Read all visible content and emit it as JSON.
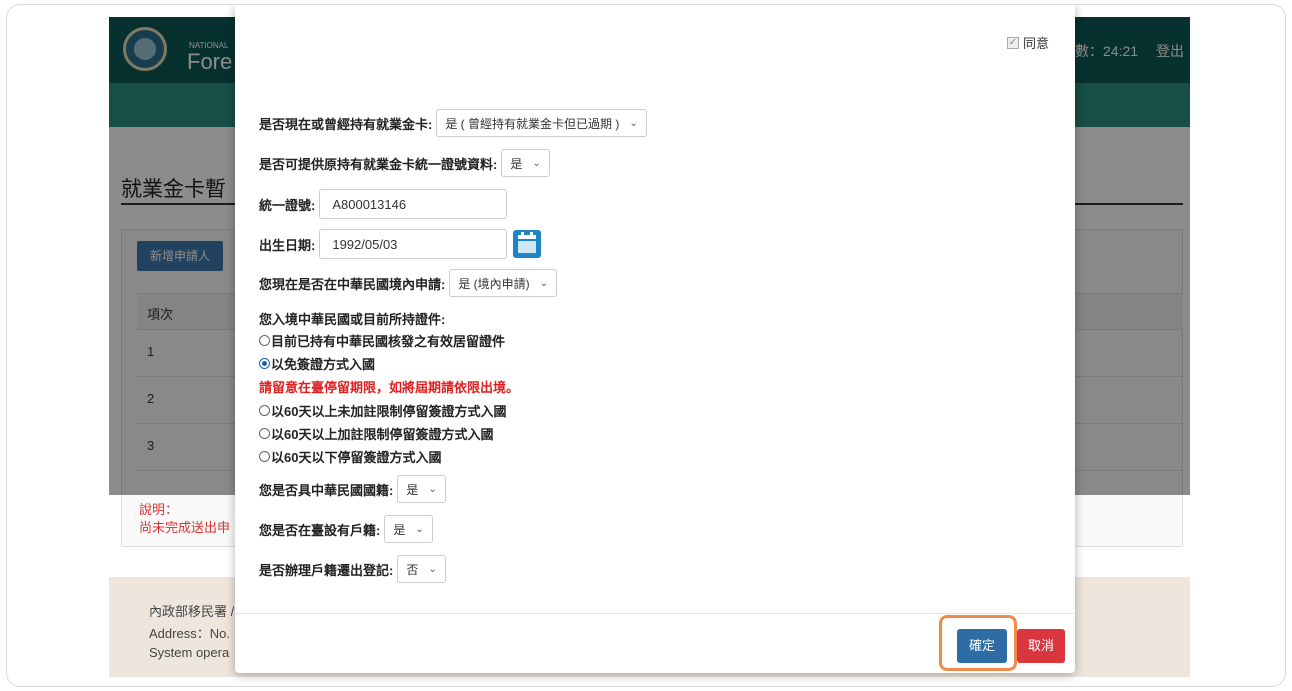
{
  "background": {
    "header": {
      "national": "NATIONAL",
      "fore": "Fore",
      "timer": "數：24:21",
      "logout": "登出"
    },
    "page_title": "就業金卡暫",
    "add_button": "新增申請人",
    "table": {
      "header": "項次",
      "rows": [
        "1",
        "2",
        "3"
      ]
    },
    "note_title": "說明：",
    "note_text": "尚未完成送出申",
    "footer": {
      "line1": "內政部移民署 /",
      "line2": "Address：No.",
      "line3": "System opera"
    }
  },
  "modal": {
    "agree_label": "同意",
    "fields": {
      "holds_card_label": "是否現在或曾經持有就業金卡:",
      "holds_card_value": "是 ( 曾經持有就業金卡但已過期 )",
      "provide_id_label": "是否可提供原持有就業金卡統一證號資料:",
      "provide_id_value": "是",
      "uid_label": "統一證號:",
      "uid_value": "A800013146",
      "dob_label": "出生日期:",
      "dob_value": "1992/05/03",
      "apply_in_roc_label": "您現在是否在中華民國境內申請:",
      "apply_in_roc_value": "是 (境內申請)",
      "entry_doc_label": "您入境中華民國或目前所持證件:",
      "radio_options": [
        {
          "label": "目前已持有中華民國核發之有效居留證件",
          "selected": false
        },
        {
          "label": "以免簽證方式入國",
          "selected": true
        },
        {
          "label": "以60天以上未加註限制停留簽證方式入國",
          "selected": false
        },
        {
          "label": "以60天以上加註限制停留簽證方式入國",
          "selected": false
        },
        {
          "label": "以60天以下停留簽證方式入國",
          "selected": false
        }
      ],
      "warning": "請留意在臺停留期限，如將屆期請依限出境。",
      "nationality_label": "您是否具中華民國國籍:",
      "nationality_value": "是",
      "household_label": "您是否在臺設有戶籍:",
      "household_value": "是",
      "moveout_label": "是否辦理戶籍遷出登記:",
      "moveout_value": "否"
    },
    "confirm_button": "確定",
    "cancel_button": "取消"
  },
  "colors": {
    "header": "#0e5a56",
    "confirm": "#2e6da4",
    "cancel": "#d9363e",
    "highlight": "#f08a4b",
    "warning": "#e02020"
  }
}
